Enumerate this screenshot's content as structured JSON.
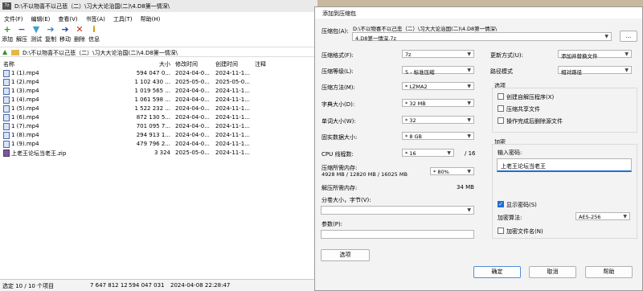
{
  "filemanager": {
    "title": "D:\\不以物喜不以己悲（二）\\习大大论治国(二)\\4.D8第一情深\\",
    "app_icon_text": "7z",
    "menu": [
      "文件(F)",
      "编辑(E)",
      "查看(V)",
      "书签(A)",
      "工具(T)",
      "帮助(H)"
    ],
    "toolbar": [
      {
        "icon": "plus-icon",
        "glyph": "+",
        "color": "#2c9b2c",
        "label": "添加"
      },
      {
        "icon": "minus-icon",
        "glyph": "−",
        "color": "#1f5fbf",
        "label": "解压"
      },
      {
        "icon": "check-arrow-icon",
        "glyph": "▼",
        "color": "#3aa0d8",
        "label": "测试"
      },
      {
        "icon": "copy-arrow-icon",
        "glyph": "➔",
        "color": "#3a7fd0",
        "label": "复制"
      },
      {
        "icon": "move-arrow-icon",
        "glyph": "➔",
        "color": "#1f3f9f",
        "label": "移动"
      },
      {
        "icon": "delete-x-icon",
        "glyph": "✕",
        "color": "#d02020",
        "label": "删除"
      },
      {
        "icon": "info-icon",
        "glyph": "i",
        "color": "#c89a10",
        "label": "信息"
      }
    ],
    "path": "D:\\不以物喜不以己悲（二）\\习大大论治国(二)\\4.D8第一情深\\",
    "columns": {
      "name": "名称",
      "size": "大小",
      "modified": "修改时间",
      "created": "创建时间",
      "note": "注释"
    },
    "files": [
      {
        "name": "1 (1).mp4",
        "size": "594 047 0...",
        "modified": "2024-04-0...",
        "created": "2024-11-1...",
        "type": "video"
      },
      {
        "name": "1 (2).mp4",
        "size": "1 102 430 ...",
        "modified": "2025-05-0...",
        "created": "2025-05-0...",
        "type": "video"
      },
      {
        "name": "1 (3).mp4",
        "size": "1 019 565 ...",
        "modified": "2024-04-0...",
        "created": "2024-11-1...",
        "type": "video"
      },
      {
        "name": "1 (4).mp4",
        "size": "1 061 598 ...",
        "modified": "2024-04-0...",
        "created": "2024-11-1...",
        "type": "video"
      },
      {
        "name": "1 (5).mp4",
        "size": "1 522 232 ...",
        "modified": "2024-04-0...",
        "created": "2024-11-1...",
        "type": "video"
      },
      {
        "name": "1 (6).mp4",
        "size": "872 130 5...",
        "modified": "2024-04-0...",
        "created": "2024-11-1...",
        "type": "video"
      },
      {
        "name": "1 (7).mp4",
        "size": "701 095 7...",
        "modified": "2024-04-0...",
        "created": "2024-11-1...",
        "type": "video"
      },
      {
        "name": "1 (8).mp4",
        "size": "294 913 1...",
        "modified": "2024-04-0...",
        "created": "2024-11-1...",
        "type": "video"
      },
      {
        "name": "1 (9).mp4",
        "size": "479 796 2...",
        "modified": "2024-04-0...",
        "created": "2024-11-1...",
        "type": "video"
      },
      {
        "name": "上老王论坛当老王.zip",
        "size": "3 324",
        "modified": "2025-05-0...",
        "created": "2024-11-1...",
        "type": "zip"
      }
    ],
    "status": {
      "selected": "选定 10 / 10 个项目",
      "total_size": "7 647 812 12",
      "selected_size": "594 047 031",
      "timestamp": "2024-04-08 22:28:47"
    }
  },
  "dialog": {
    "title": "添加到压缩包",
    "archive_label": "压缩包(A):",
    "archive_dir": "D:\\不以物喜不以己悲（二）\\习大大论治国(二)\\4.D8第一情深\\",
    "archive_name": "4.D8第一情深.7z",
    "browse_label": "...",
    "format_label": "压缩格式(F):",
    "format_value": "7z",
    "level_label": "压缩等级(L):",
    "level_value": "5 - 标准压缩",
    "method_label": "压缩方法(M):",
    "method_value": "* LZMA2",
    "dict_label": "字典大小(D):",
    "dict_value": "* 32 MB",
    "word_label": "单词大小(W):",
    "word_value": "* 32",
    "solid_label": "固实数据大小:",
    "solid_value": "* 8 GB",
    "cpu_label": "CPU 线程数:",
    "cpu_value": "* 16",
    "cpu_max": "/ 16",
    "mem_label": "压缩所需内存:",
    "mem_detail": "4928 MB / 12820 MB / 16025 MB",
    "mem_percent": "* 80%",
    "decomp_label": "解压所需内存:",
    "decomp_value": "34 MB",
    "split_label": "分卷大小，字节(V):",
    "params_label": "参数(P):",
    "options_button": "选项",
    "update_label": "更新方式(U):",
    "update_value": "添加并替换文件",
    "path_label": "路径模式",
    "path_value": "相对路径",
    "options_title": "选项",
    "opt_sfx": "创建自解压程序(X)",
    "opt_shared": "压缩共享文件",
    "opt_delete": "操作完成后删除源文件",
    "encrypt_title": "加密",
    "password_label": "输入密码:",
    "password_value": "上老王论坛当老王",
    "show_password": "显示密码(S)",
    "enc_method_label": "加密算法:",
    "enc_method_value": "AES-256",
    "enc_names": "加密文件名(N)",
    "ok_button": "确定",
    "cancel_button": "取消",
    "help_button": "帮助"
  }
}
